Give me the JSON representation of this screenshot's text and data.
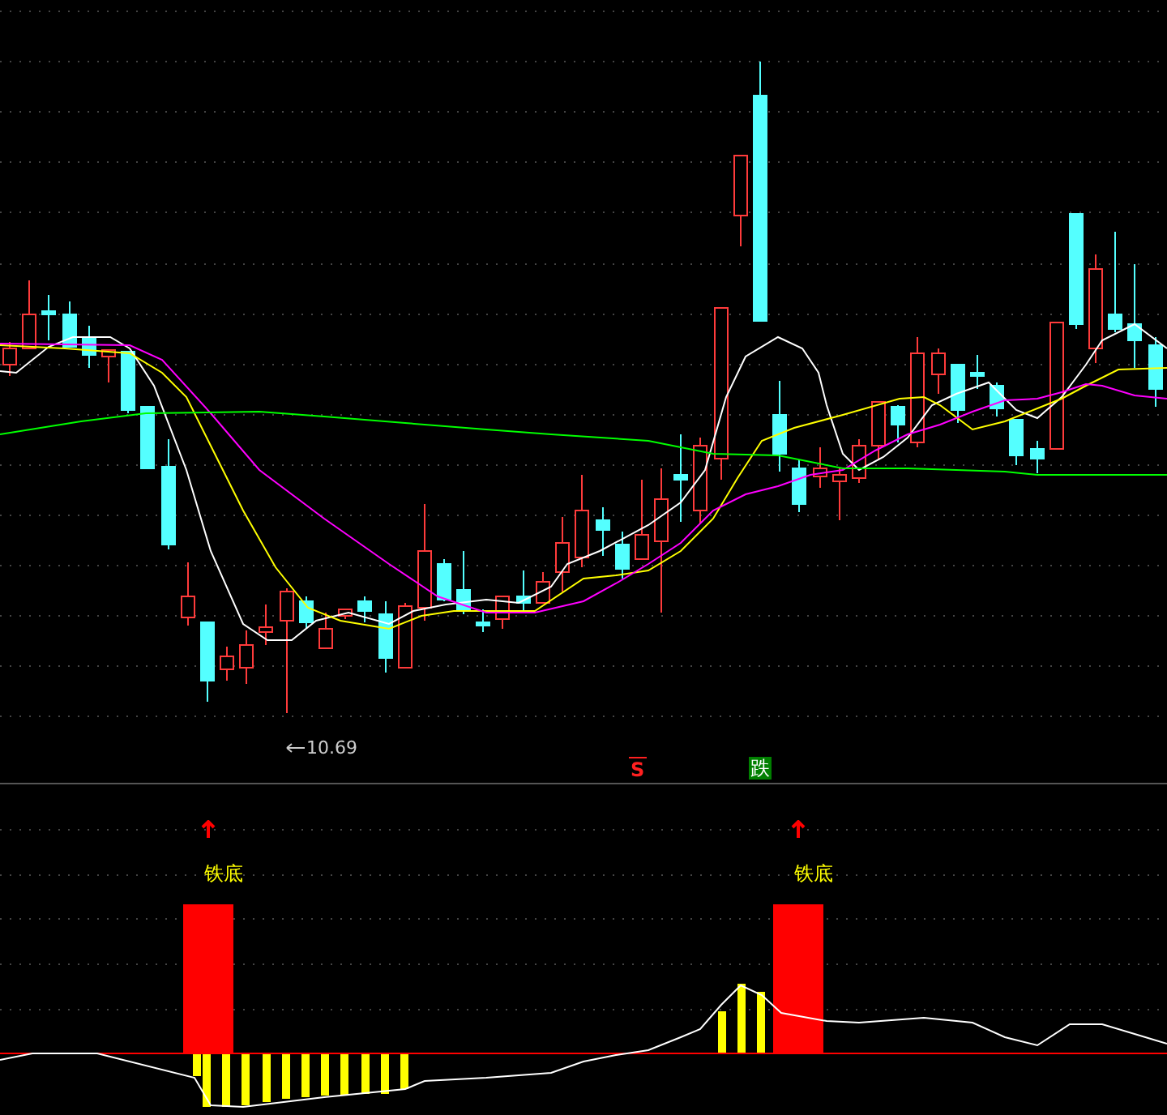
{
  "price_panel": {
    "low_marker": "10.69",
    "signals": [
      {
        "kind": "sell",
        "text": "S"
      },
      {
        "kind": "fall",
        "text": "跌"
      }
    ]
  },
  "indicator_panel": {
    "signals": [
      {
        "label": "铁底"
      },
      {
        "label": "铁底"
      }
    ]
  }
}
